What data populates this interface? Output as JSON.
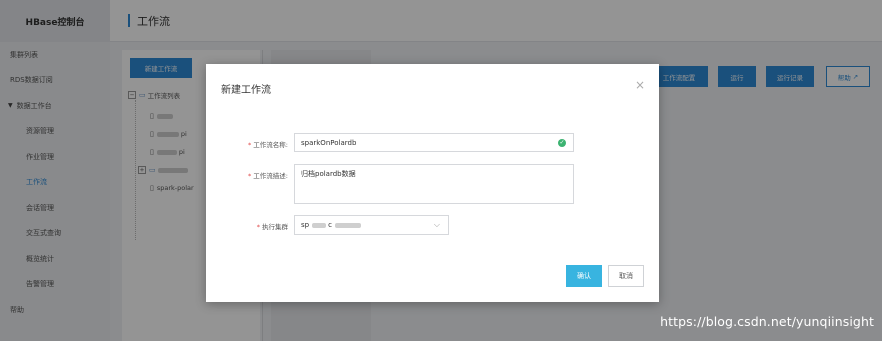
{
  "sidebar": {
    "brand": "HBase控制台",
    "items": [
      {
        "label": "集群列表"
      },
      {
        "label": "RDS数据订阅"
      },
      {
        "label": "数据工作台"
      },
      {
        "label": "资源管理"
      },
      {
        "label": "作业管理"
      },
      {
        "label": "工作流"
      },
      {
        "label": "会话管理"
      },
      {
        "label": "交互式查询"
      },
      {
        "label": "概览统计"
      },
      {
        "label": "告警管理"
      },
      {
        "label": "帮助"
      }
    ]
  },
  "header": {
    "title": "工作流"
  },
  "left_panel": {
    "new_button": "新建工作流",
    "tree_root": "工作流列表",
    "items": [
      {
        "suffix": ""
      },
      {
        "suffix": "pi"
      },
      {
        "suffix": "pi"
      },
      {
        "suffix": ""
      },
      {
        "suffix": "spark-polar"
      }
    ]
  },
  "toolbar": {
    "config": "工作流配置",
    "run": "运行",
    "records": "运行记录",
    "help": "帮助"
  },
  "modal": {
    "title": "新建工作流",
    "name_label": "工作流名称:",
    "name_value": "sparkOnPolardb",
    "desc_label": "工作流描述:",
    "desc_value": "归档polardb数据",
    "cluster_label": "执行集群",
    "cluster_value": "sp",
    "cluster_value_2": "c",
    "confirm": "确认",
    "cancel": "取消"
  },
  "watermark": "https://blog.csdn.net/yunqiinsight",
  "colors": {
    "accent": "#2e8bd6",
    "confirm": "#38b4e0",
    "valid": "#3cb371",
    "required": "#e04848"
  }
}
